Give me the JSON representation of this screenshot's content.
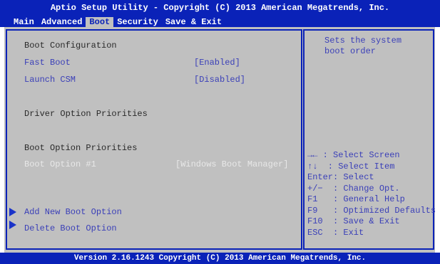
{
  "title": "Aptio Setup Utility - Copyright (C) 2013 American Megatrends, Inc.",
  "tabs": [
    "Main",
    "Advanced",
    "Boot",
    "Security",
    "Save & Exit"
  ],
  "active_tab": "Boot",
  "content": {
    "boot_configuration": "Boot Configuration",
    "fast_boot_label": "Fast Boot",
    "fast_boot_value": "[Enabled]",
    "launch_csm_label": "Launch CSM",
    "launch_csm_value": "[Disabled]",
    "driver_option_priorities": "Driver Option Priorities",
    "boot_option_priorities": "Boot Option Priorities",
    "boot_option_1_label": "Boot Option #1",
    "boot_option_1_value": "[Windows Boot Manager]",
    "add_new_boot_option": "Add New Boot Option",
    "delete_boot_option": "Delete Boot Option"
  },
  "help": {
    "line1": "Sets the system",
    "line2": "boot order"
  },
  "keys": [
    "→← : Select Screen",
    "↑↓  : Select Item",
    "Enter: Select",
    "+/−  : Change Opt.",
    "F1   : General Help",
    "F9   : Optimized Defaults",
    "F10  : Save & Exit",
    "ESC  : Exit"
  ],
  "footer": "Version 2.16.1243 Copyright (C) 2013 American Megatrends, Inc.",
  "colors": {
    "header_bg": "#0a22b8",
    "panel_bg": "#c0c0c0",
    "text_blue": "#3a3fb8",
    "text_dark": "#2a2a2a"
  }
}
